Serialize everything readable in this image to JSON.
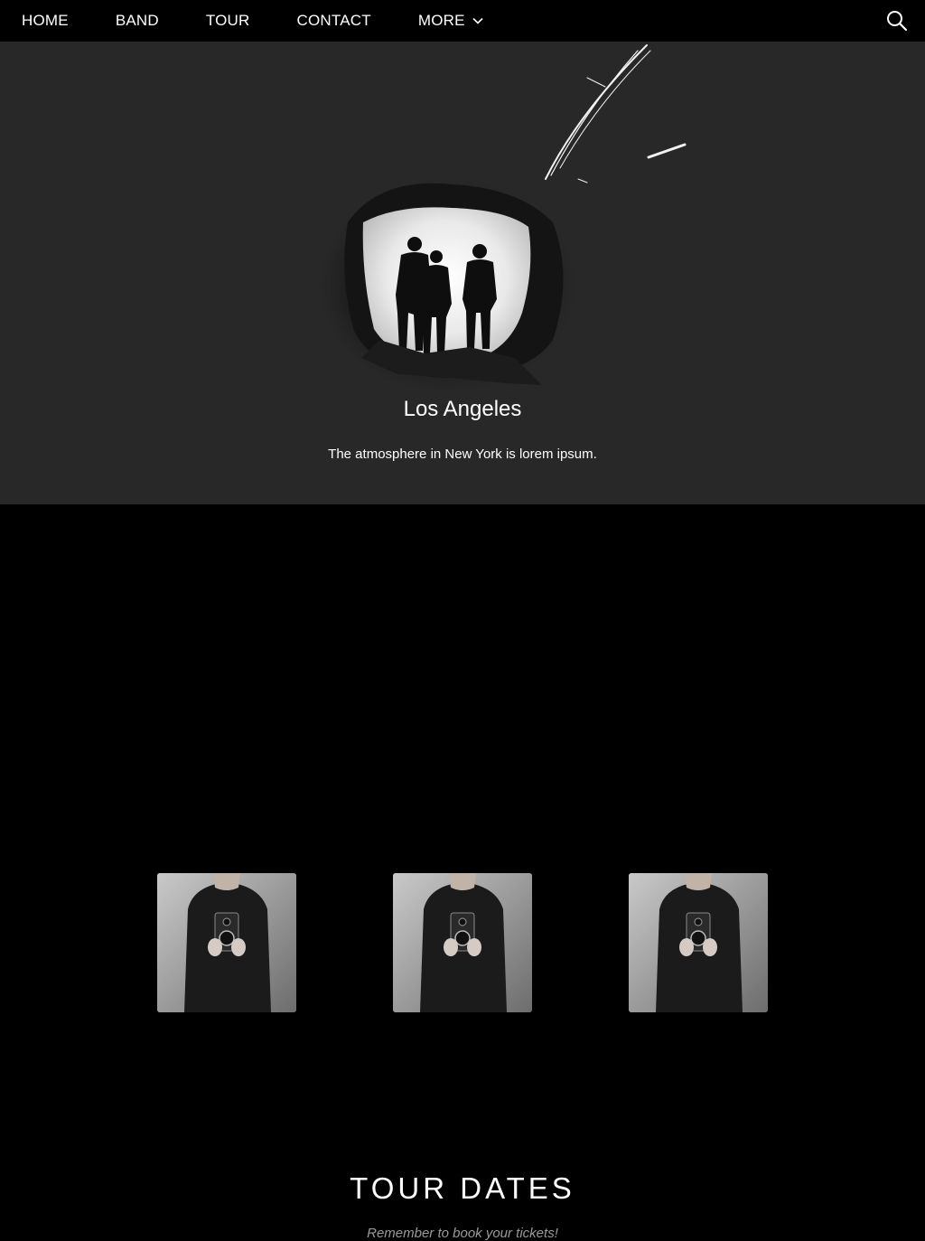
{
  "nav": {
    "items": [
      {
        "label": "HOME"
      },
      {
        "label": "BAND"
      },
      {
        "label": "TOUR"
      },
      {
        "label": "CONTACT"
      },
      {
        "label": "MORE"
      }
    ],
    "more_icon": "chevron-down-icon",
    "search_icon": "search-icon"
  },
  "hero": {
    "title": "Los Angeles",
    "caption": "The atmosphere in New York is lorem ipsum."
  },
  "gallery": {
    "images": [
      {
        "icon": "person-with-camera-photo"
      },
      {
        "icon": "person-with-camera-photo"
      },
      {
        "icon": "person-with-camera-photo"
      }
    ]
  },
  "tour": {
    "heading": "TOUR DATES",
    "subheading": "Remember to book your tickets!"
  },
  "colors": {
    "nav_bg": "#000000",
    "hero_bg": "#282828",
    "section_bg": "#000000",
    "text": "#ffffff",
    "muted": "#9a9a9a"
  }
}
